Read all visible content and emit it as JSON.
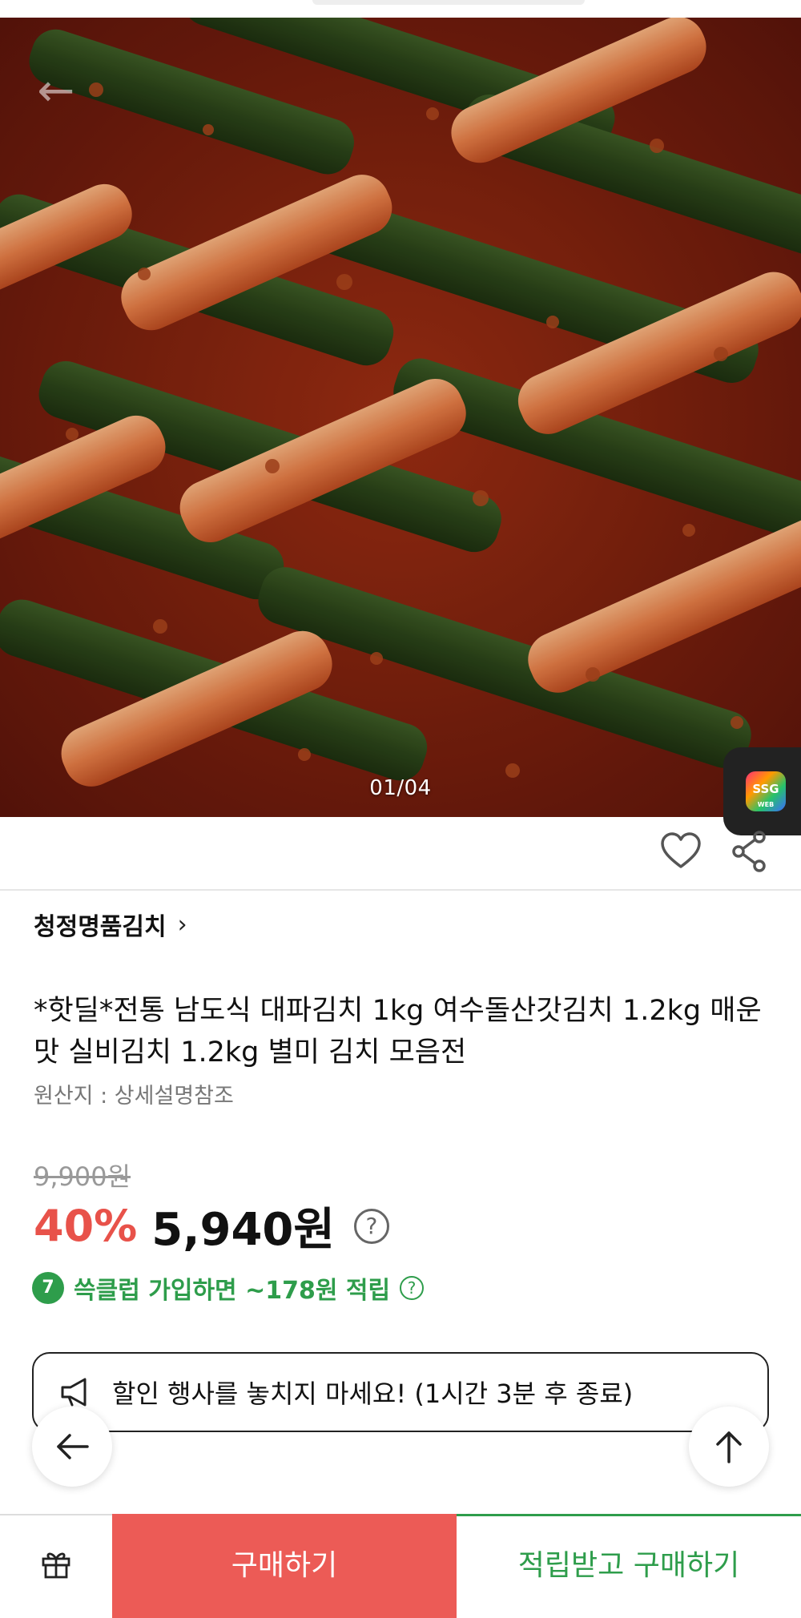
{
  "hero": {
    "pager": "01/04",
    "back_icon": "arrow-left-icon"
  },
  "side_tab": {
    "logo_text": "SSG",
    "logo_sub": "WEB"
  },
  "actions": {
    "wishlist_icon": "heart-icon",
    "share_icon": "share-icon"
  },
  "product": {
    "seller": "청정명품김치",
    "title": "*핫딜*전통 남도식 대파김치 1kg 여수돌산갓김치 1.2kg 매운맛 실비김치 1.2kg 별미 김치 모음전",
    "origin": "원산지 : 상세설명참조"
  },
  "price": {
    "original": "9,900원",
    "discount": "40%",
    "sale": "5,940원",
    "help": "?"
  },
  "club": {
    "badge": "7",
    "text": "쓱클럽 가입하면 ~178원 적립",
    "help": "?"
  },
  "promo": {
    "icon": "megaphone-icon",
    "text": "할인 행사를 놓치지 마세요! (1시간 3분 후 종료)"
  },
  "floating": {
    "back_icon": "arrow-left-icon",
    "top_icon": "arrow-up-icon"
  },
  "bottom_bar": {
    "gift_icon": "gift-icon",
    "buy_label": "구매하기",
    "earn_buy_label": "적립받고 구매하기"
  },
  "colors": {
    "accent_red": "#ec5b56",
    "discount_red": "#e8524a",
    "club_green": "#2e9d4b"
  }
}
